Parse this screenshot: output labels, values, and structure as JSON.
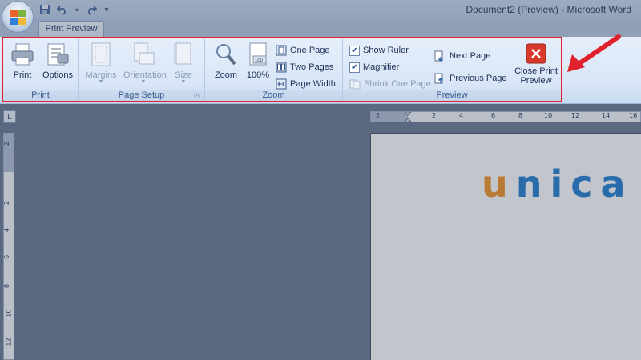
{
  "window": {
    "title": "Document2 (Preview) - Microsoft Word"
  },
  "qat": {
    "save_icon": "save-icon",
    "undo_icon": "undo-icon",
    "redo_icon": "redo-icon",
    "customize_icon": "customize-qat-icon"
  },
  "tabs": [
    {
      "label": "Print Preview"
    }
  ],
  "ribbon": {
    "print": {
      "group_label": "Print",
      "print_label": "Print",
      "options_label": "Options"
    },
    "page_setup": {
      "group_label": "Page Setup",
      "margins_label": "Margins",
      "orientation_label": "Orientation",
      "size_label": "Size"
    },
    "zoom": {
      "group_label": "Zoom",
      "zoom_label": "Zoom",
      "hundred_label": "100%",
      "one_page_label": "One Page",
      "two_pages_label": "Two Pages",
      "page_width_label": "Page Width"
    },
    "preview": {
      "group_label": "Preview",
      "show_ruler_label": "Show Ruler",
      "show_ruler_checked": true,
      "magnifier_label": "Magnifier",
      "magnifier_checked": true,
      "shrink_label": "Shrink One Page",
      "next_page_label": "Next Page",
      "previous_page_label": "Previous Page",
      "close_label_line1": "Close Print",
      "close_label_line2": "Preview"
    }
  },
  "ruler": {
    "horizontal_ticks": [
      "2",
      "2",
      "4",
      "6",
      "8",
      "10",
      "12",
      "14",
      "16"
    ],
    "vertical_ticks": [
      "2",
      "2",
      "4",
      "6",
      "8",
      "10",
      "12"
    ]
  },
  "document": {
    "logo_u": "u",
    "logo_rest": "nica"
  },
  "colors": {
    "highlight": "#e0202a",
    "logo_blue": "#1a7bd0",
    "logo_orange": "#f29020"
  }
}
